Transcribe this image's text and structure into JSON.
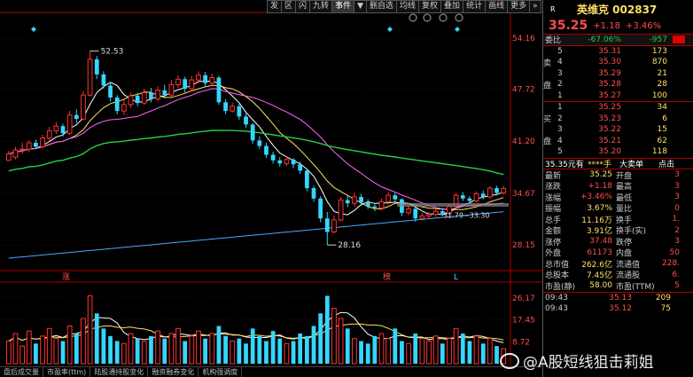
{
  "toolbar": {
    "items": [
      "发",
      "区",
      "闪",
      "九转",
      "事件",
      "▼",
      "删自选",
      "均线",
      "复权",
      "叠加",
      "统计",
      "画线",
      "更多",
      "»"
    ]
  },
  "chart": {
    "price_axis": [
      "54.16",
      "47.72",
      "41.20",
      "34.67",
      "28.15"
    ],
    "volume_axis": [
      "26.17",
      "17.45",
      "8.72"
    ],
    "annotation_high": "52.53",
    "annotation_low": "28.16",
    "annotation_line": "31.79~33.30",
    "markers": {
      "zhang": "涨",
      "bang": "榜",
      "l": "L"
    },
    "colors": {
      "up": "#ff3333",
      "down": "#35d6ff",
      "ma5": "#ffffff",
      "ma10": "#ffe066",
      "ma20": "#ff66ff",
      "ma60": "#22d04a",
      "ma120": "#4aa8ff"
    }
  },
  "chart_data": {
    "type": "candlestick",
    "ylim": [
      25.5,
      56.5
    ],
    "volume_ylim": [
      0,
      30
    ],
    "candles": [
      [
        38.8,
        39.6,
        39.2,
        40.0
      ],
      [
        39.2,
        40.1,
        38.9,
        40.5
      ],
      [
        40.1,
        40.2,
        39.6,
        41.0
      ],
      [
        40.2,
        41.0,
        39.8,
        41.3
      ],
      [
        41.0,
        40.5,
        40.2,
        41.4
      ],
      [
        40.5,
        41.6,
        40.3,
        42.0
      ],
      [
        41.6,
        42.5,
        41.2,
        43.0
      ],
      [
        42.5,
        43.1,
        42.1,
        43.6
      ],
      [
        43.1,
        42.2,
        41.8,
        43.4
      ],
      [
        42.2,
        44.5,
        42.0,
        45.0
      ],
      [
        44.5,
        44.0,
        43.5,
        45.2
      ],
      [
        44.0,
        47.0,
        43.8,
        47.5
      ],
      [
        47.0,
        51.5,
        46.8,
        52.53
      ],
      [
        51.5,
        49.6,
        49.0,
        51.9
      ],
      [
        49.6,
        48.2,
        47.8,
        50.0
      ],
      [
        48.2,
        46.7,
        46.2,
        48.6
      ],
      [
        46.7,
        45.0,
        44.6,
        47.0
      ],
      [
        45.0,
        45.8,
        44.5,
        46.4
      ],
      [
        45.8,
        46.9,
        45.4,
        47.3
      ],
      [
        46.9,
        46.0,
        45.6,
        47.3
      ],
      [
        46.0,
        47.3,
        45.8,
        47.8
      ],
      [
        47.3,
        46.5,
        46.1,
        47.9
      ],
      [
        46.5,
        47.6,
        46.2,
        48.1
      ],
      [
        47.6,
        47.0,
        46.6,
        48.3
      ],
      [
        47.0,
        48.3,
        46.8,
        48.9
      ],
      [
        48.3,
        49.0,
        47.9,
        49.5
      ],
      [
        49.0,
        47.8,
        47.3,
        49.3
      ],
      [
        47.8,
        48.9,
        47.5,
        49.4
      ],
      [
        48.9,
        49.5,
        48.5,
        50.0
      ],
      [
        49.5,
        48.5,
        48.0,
        49.9
      ],
      [
        48.5,
        49.2,
        48.1,
        49.7
      ],
      [
        49.2,
        46.1,
        45.8,
        49.4
      ],
      [
        46.1,
        45.0,
        44.6,
        46.5
      ],
      [
        45.0,
        45.6,
        44.8,
        46.0
      ],
      [
        45.6,
        44.3,
        43.9,
        45.9
      ],
      [
        44.3,
        43.3,
        42.9,
        44.7
      ],
      [
        43.3,
        41.3,
        40.9,
        43.5
      ],
      [
        41.3,
        40.6,
        40.2,
        41.8
      ],
      [
        40.6,
        39.5,
        39.1,
        41.0
      ],
      [
        39.5,
        38.8,
        38.4,
        39.9
      ],
      [
        38.8,
        38.4,
        38.0,
        39.2
      ],
      [
        38.4,
        38.9,
        38.1,
        39.3
      ],
      [
        38.9,
        38.3,
        37.8,
        39.1
      ],
      [
        38.3,
        37.5,
        37.1,
        38.6
      ],
      [
        37.5,
        35.3,
        34.9,
        37.7
      ],
      [
        35.3,
        34.0,
        33.6,
        35.6
      ],
      [
        34.0,
        31.5,
        31.0,
        34.3
      ],
      [
        31.5,
        29.8,
        28.16,
        32.3
      ],
      [
        29.8,
        31.3,
        29.6,
        31.8
      ],
      [
        31.3,
        33.8,
        31.1,
        34.2
      ],
      [
        33.8,
        33.4,
        32.9,
        34.3
      ],
      [
        33.4,
        34.2,
        33.0,
        34.7
      ],
      [
        34.2,
        33.5,
        33.1,
        34.6
      ],
      [
        33.5,
        33.0,
        32.7,
        33.9
      ],
      [
        33.0,
        32.8,
        32.4,
        33.4
      ],
      [
        32.8,
        33.6,
        32.5,
        34.0
      ],
      [
        33.6,
        34.4,
        33.2,
        34.8
      ],
      [
        34.4,
        33.9,
        33.5,
        34.7
      ],
      [
        33.9,
        32.2,
        31.8,
        34.0
      ],
      [
        32.2,
        32.7,
        31.9,
        33.1
      ],
      [
        32.7,
        31.5,
        31.1,
        32.9
      ],
      [
        31.5,
        31.8,
        31.2,
        32.2
      ],
      [
        31.8,
        32.0,
        31.4,
        32.3
      ],
      [
        32.0,
        32.4,
        31.7,
        32.8
      ],
      [
        32.4,
        32.1,
        31.8,
        32.8
      ],
      [
        32.1,
        33.0,
        31.9,
        33.3
      ],
      [
        33.0,
        34.4,
        32.8,
        34.7
      ],
      [
        34.4,
        34.0,
        33.7,
        34.8
      ],
      [
        34.0,
        33.7,
        33.4,
        34.3
      ],
      [
        33.7,
        34.6,
        33.5,
        34.9
      ],
      [
        34.6,
        34.2,
        33.9,
        35.0
      ],
      [
        34.2,
        35.3,
        34.0,
        35.5
      ],
      [
        35.3,
        34.7,
        34.4,
        35.6
      ],
      [
        34.7,
        35.25,
        34.5,
        35.6
      ]
    ],
    "volumes": [
      9,
      12,
      7,
      13,
      8,
      11,
      14,
      10,
      9,
      15,
      12,
      18,
      27,
      20,
      14,
      11,
      9,
      8,
      12,
      10,
      9,
      11,
      13,
      10,
      12,
      14,
      9,
      11,
      13,
      10,
      12,
      15,
      11,
      9,
      10,
      8,
      14,
      11,
      9,
      13,
      10,
      8,
      9,
      12,
      11,
      15,
      20,
      27,
      22,
      18,
      14,
      10,
      9,
      8,
      11,
      12,
      10,
      14,
      9,
      8,
      12,
      10,
      9,
      11,
      8,
      10,
      14,
      12,
      9,
      11,
      8,
      10,
      7,
      6
    ]
  },
  "bottom_tabs": [
    "盘后成交量",
    "市盈率(ttm)",
    "陆股通持股变化",
    "融资融券变化",
    "机构强调度"
  ],
  "panel": {
    "r_label": "R",
    "title": "英维克 002837",
    "price": "35.25",
    "change": "+1.18",
    "change_pct": "+3.46%",
    "ratio_label": "委比",
    "ratio_val": "-67.06%",
    "ratio_diff": "-957",
    "sell": [
      {
        "n": "5",
        "p": "35.31",
        "v": "173"
      },
      {
        "n": "4",
        "p": "35.30",
        "v": "870"
      },
      {
        "n": "3",
        "p": "35.29",
        "v": "21"
      },
      {
        "n": "2",
        "p": "35.28",
        "v": "28"
      },
      {
        "n": "1",
        "p": "35.27",
        "v": "100"
      }
    ],
    "sell_side": [
      "卖",
      "盘"
    ],
    "buy": [
      {
        "n": "1",
        "p": "35.25",
        "v": "34"
      },
      {
        "n": "2",
        "p": "35.23",
        "v": "6"
      },
      {
        "n": "3",
        "p": "35.22",
        "v": "15"
      },
      {
        "n": "4",
        "p": "35.21",
        "v": "62"
      },
      {
        "n": "5",
        "p": "35.20",
        "v": "118"
      }
    ],
    "buy_side": [
      "买",
      "盘"
    ],
    "mid_left": "35.35元有",
    "mid_stars": "****手",
    "mid_right": "大卖单",
    "mid_far": "点击",
    "stats": [
      {
        "k": "最新",
        "v": "35.25",
        "k2": "开盘",
        "v2": "3"
      },
      {
        "k": "涨跌",
        "v": "+1.18",
        "k2": "最高",
        "v2": "3"
      },
      {
        "k": "涨幅",
        "v": "+3.46%",
        "k2": "最低",
        "v2": "3"
      },
      {
        "k": "振幅",
        "v": "3.67%",
        "k2": "量比",
        "v2": "0"
      },
      {
        "k": "总手",
        "v": "11.16万",
        "k2": "换手",
        "v2": "1."
      },
      {
        "k": "金额",
        "v": "3.91亿",
        "k2": "换手(实)",
        "v2": "2"
      },
      {
        "k": "涨停",
        "v": "37.48",
        "k2": "跌停",
        "v2": "3"
      },
      {
        "k": "外盘",
        "v": "61173",
        "k2": "内盘",
        "v2": "50"
      },
      {
        "k": "总市值",
        "v": "262.6亿",
        "k2": "流通值",
        "v2": "228."
      },
      {
        "k": "总股本",
        "v": "7.45亿",
        "k2": "流通股",
        "v2": "6."
      },
      {
        "k": "市盈(静)",
        "v": "58.00",
        "k2": "市盈(TTM)",
        "v2": "5"
      }
    ],
    "ticks": [
      {
        "t": "09:43",
        "p": "35.13",
        "v": "209"
      },
      {
        "t": "09:43",
        "p": "35.12",
        "v": "75"
      }
    ]
  },
  "watermark": "@A股短线狙击莉姐"
}
